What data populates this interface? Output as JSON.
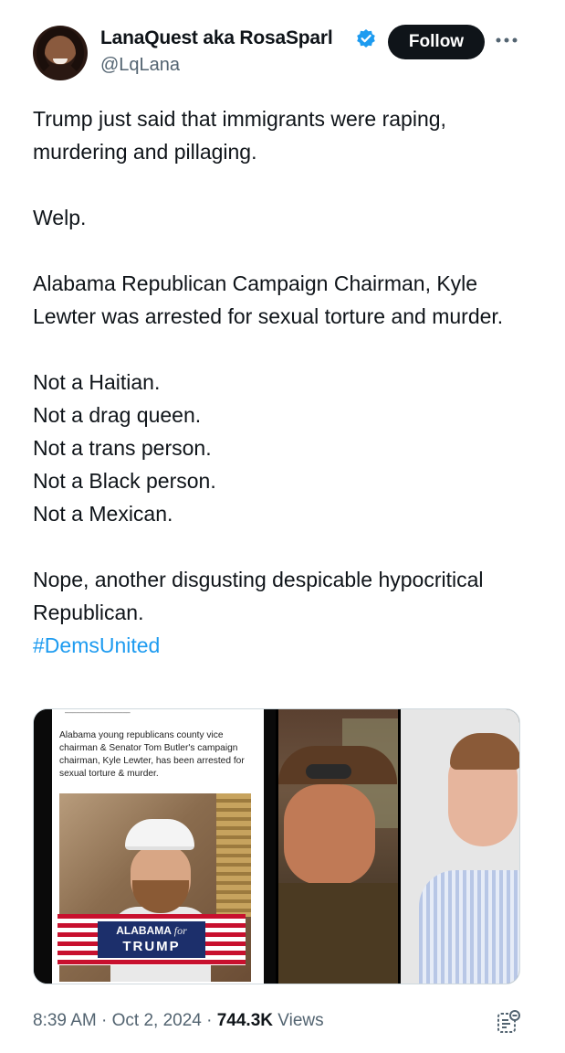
{
  "author": {
    "display_name": "LanaQuest aka RosaSparl",
    "handle": "@LqLana",
    "avatar_icon": "profile-photo",
    "verified_icon": "verified-badge-icon",
    "verified_color": "#1d9bf0"
  },
  "actions": {
    "follow_label": "Follow",
    "more_icon": "more-horizontal-icon"
  },
  "tweet": {
    "paragraphs": [
      "Trump just said that immigrants were raping, murdering and pillaging.",
      "",
      "Welp.",
      "",
      "Alabama Republican Campaign Chairman, Kyle Lewter was arrested for sexual torture and murder.",
      "",
      "Not a Haitian.",
      "Not a drag queen.",
      "Not a trans person.",
      "Not a Black person.",
      "Not a Mexican.",
      "",
      "Nope, another disgusting despicable hypocritical Republican."
    ],
    "hashtag": "#DemsUnited",
    "hashtag_color": "#1d9bf0"
  },
  "media": {
    "caption": "Alabama young republicans county vice chairman & Senator Tom Butler's campaign chairman, Kyle Lewter, has been arrested for sexual torture & murder.",
    "banner_line1": "ALABAMA",
    "banner_for": "for",
    "banner_line2": "TRUMP"
  },
  "footer": {
    "time": "8:39 AM",
    "sep1": " · ",
    "date": "Oct 2, 2024",
    "sep2": " · ",
    "views_count": "744.3K",
    "views_label": " Views",
    "analytics_icon": "post-analytics-icon"
  }
}
